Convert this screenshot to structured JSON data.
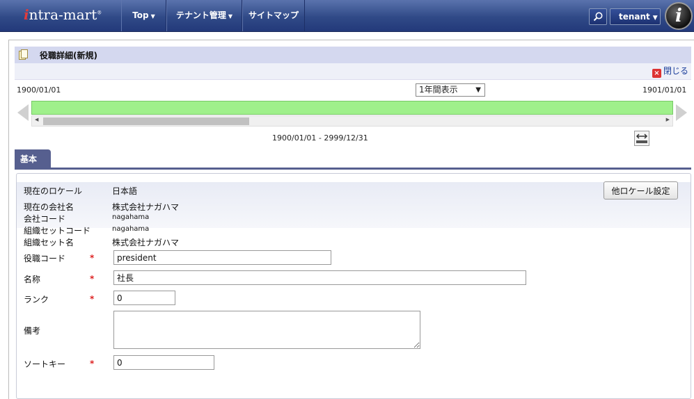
{
  "header": {
    "logo": "intra-mart",
    "menu": [
      "Top",
      "テナント管理",
      "サイトマップ"
    ],
    "user": "tenant"
  },
  "page": {
    "title": "役職詳細(新規)",
    "close_label": "閉じる"
  },
  "timeline": {
    "start_date": "1900/01/01",
    "end_date": "1901/01/01",
    "view_select": "1年間表示",
    "range_label": "1900/01/01 - 2999/12/31"
  },
  "tabs": [
    "基本"
  ],
  "form": {
    "current_locale_label": "現在のロケール",
    "current_locale_value": "日本語",
    "other_locale_button": "他ロケール設定",
    "company_name_label": "現在の会社名",
    "company_name_value": "株式会社ナガハマ",
    "company_code_label": "会社コード",
    "company_code_value": "nagahama",
    "org_set_code_label": "組織セットコード",
    "org_set_code_value": "nagahama",
    "org_set_name_label": "組織セット名",
    "org_set_name_value": "株式会社ナガハマ",
    "post_code_label": "役職コード",
    "post_code_value": "president",
    "name_label": "名称",
    "name_value": "社長",
    "rank_label": "ランク",
    "rank_value": "0",
    "notes_label": "備考",
    "notes_value": "",
    "sort_key_label": "ソートキー",
    "sort_key_value": "0",
    "required_mark": "*"
  },
  "colors": {
    "header": "#304a87",
    "tab": "#565f8f",
    "timeline_bar": "#9ff08b"
  }
}
